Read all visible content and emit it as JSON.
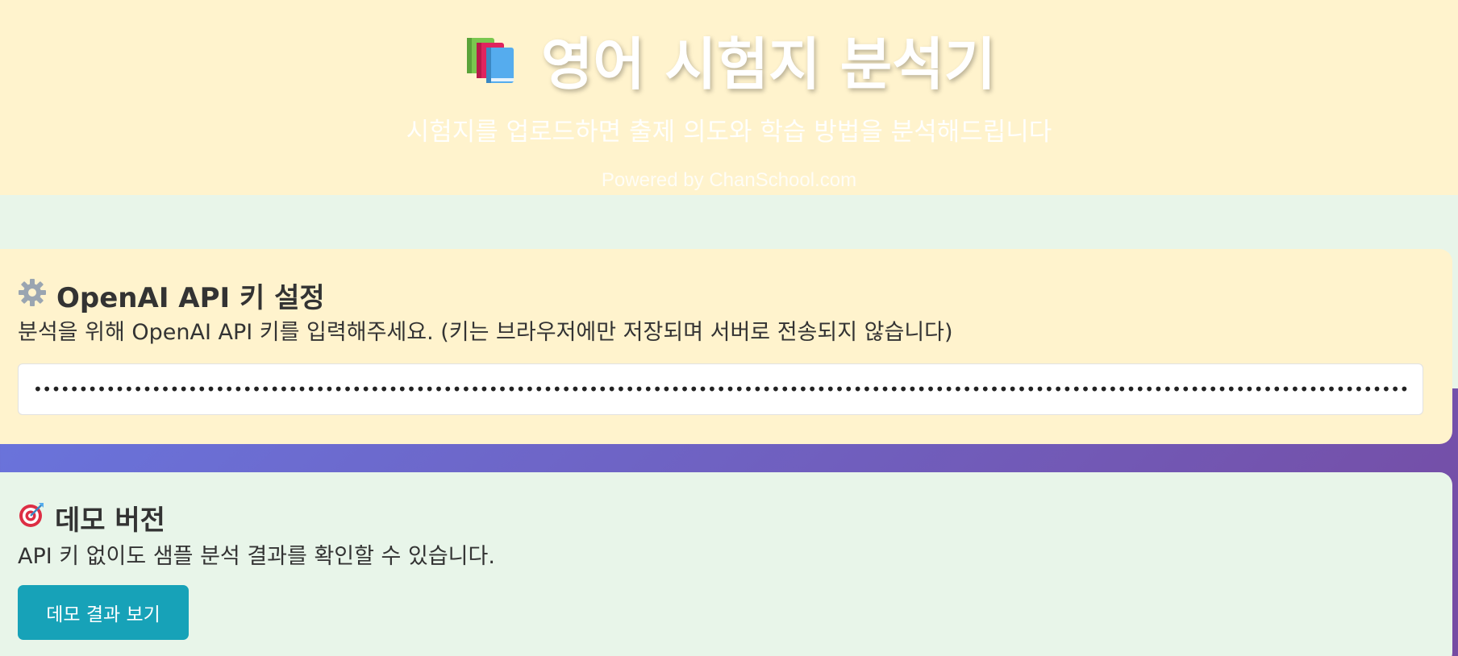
{
  "header": {
    "title": "영어 시험지 분석기",
    "subtitle": "시험지를 업로드하면 출제 의도와 학습 방법을 분석해드립니다",
    "powered_by": "Powered by ChanSchool.com",
    "title_icon": "books-icon"
  },
  "api_section": {
    "icon": "gear-icon",
    "title": "OpenAI API 키 설정",
    "description": "분석을 위해 OpenAI API 키를 입력해주세요. (키는 브라우저에만 저장되며 서버로 전송되지 않습니다)",
    "input_value": "••••••••••••••••••••••••••••••••••••••••••••••••••••••••••••••••••••••••••••••••••••••••••••••••••••••••••••••••••••••••••••••••••••••••••••••••••••••••••••••••••••••••••••"
  },
  "demo_section": {
    "icon": "target-icon",
    "title": "데모 버전",
    "description": "API 키 없이도 샘플 분석 결과를 확인할 수 있습니다.",
    "button_label": "데모 결과 보기"
  },
  "colors": {
    "gradient_start": "#667eea",
    "gradient_end": "#764ba2",
    "api_card_bg": "#fff3cd",
    "demo_card_bg": "#e8f5e9",
    "button_bg": "#17a2b8"
  }
}
